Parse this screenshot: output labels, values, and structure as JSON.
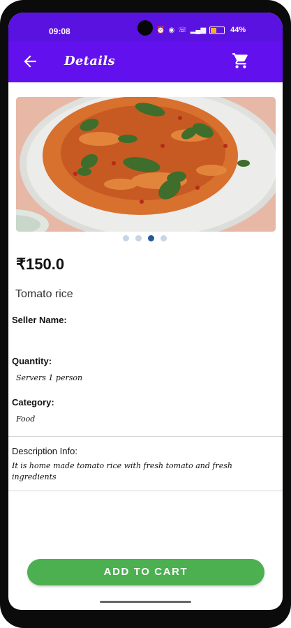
{
  "status_bar": {
    "time": "09:08",
    "battery_percent": "44%",
    "icons": [
      "alarm-icon",
      "wifi-icon",
      "call-icon",
      "signal-icon",
      "battery-icon"
    ]
  },
  "app_bar": {
    "title": "Details",
    "back_icon": "arrow-left-icon",
    "cart_icon": "cart-icon",
    "background": "#6210ee"
  },
  "carousel": {
    "image_alt": "Plate of tomato rice with basil leaves",
    "dots": [
      {
        "active": false
      },
      {
        "active": false
      },
      {
        "active": true
      },
      {
        "active": false
      }
    ]
  },
  "product": {
    "price": "₹150.0",
    "name": "Tomato rice",
    "seller_label": "Seller Name:",
    "seller_value": "",
    "quantity_label": "Quantity:",
    "quantity_value": "Servers 1 person",
    "category_label": "Category:",
    "category_value": "Food",
    "description_label": "Description Info:",
    "description_value": "It is home made tomato rice with fresh tomato and fresh ingredients"
  },
  "actions": {
    "add_to_cart": "ADD TO CART",
    "accent": "#4caf50"
  }
}
